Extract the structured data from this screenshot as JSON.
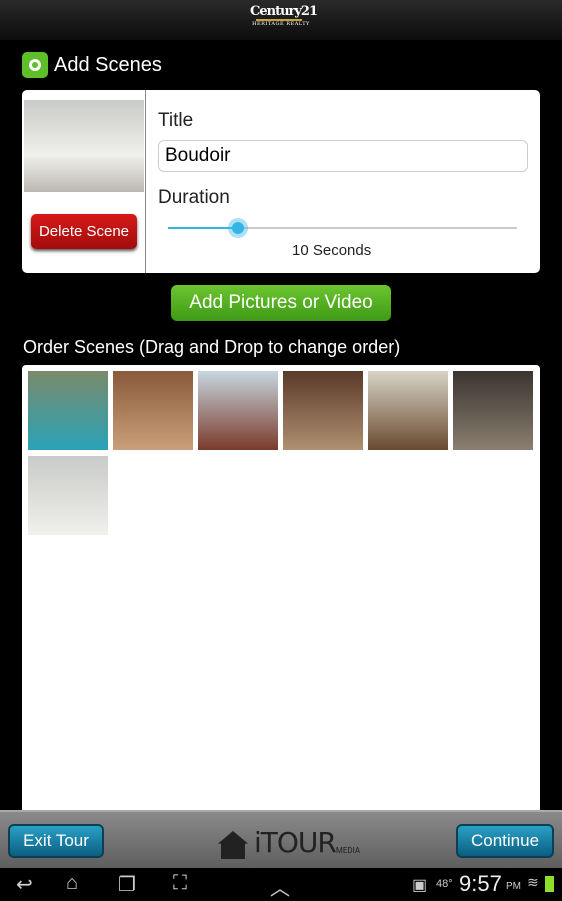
{
  "topbar": {
    "logo_text": "Century 21",
    "logo_sub": "Heritage Realty"
  },
  "header": {
    "title": "Add Scenes",
    "icon": "scene-camera-icon",
    "icon_color": "#5fbf2a"
  },
  "scene": {
    "delete_label": "Delete Scene",
    "title_label": "Title",
    "title_value": "Boudoir",
    "duration_label": "Duration",
    "duration_text": "10 Seconds",
    "duration_fraction": 0.2
  },
  "add_pictures_label": "Add Pictures or Video",
  "order_label": "Order Scenes (Drag and Drop to change order)",
  "scenes": [
    {
      "name": "pool-exterior",
      "colors": [
        "#7a8a6a",
        "#2aa3b8"
      ]
    },
    {
      "name": "living-room",
      "colors": [
        "#8a5a3a",
        "#c9a07a"
      ]
    },
    {
      "name": "dining-room",
      "colors": [
        "#c7d7e0",
        "#7a3a2a"
      ]
    },
    {
      "name": "kitchen",
      "colors": [
        "#5a3a2a",
        "#b09070"
      ]
    },
    {
      "name": "hallway",
      "colors": [
        "#d8d4c8",
        "#6a4a30"
      ]
    },
    {
      "name": "theater-room",
      "colors": [
        "#3a3530",
        "#8a7f70"
      ]
    },
    {
      "name": "boudoir",
      "colors": [
        "#c9cbc8",
        "#f0f0ec"
      ]
    }
  ],
  "bottom": {
    "exit_label": "Exit Tour",
    "continue_label": "Continue",
    "brand": "iTOUR",
    "brand_sub": "MEDIA"
  },
  "statusbar": {
    "temperature": "48°",
    "time": "9:57",
    "ampm": "PM"
  }
}
